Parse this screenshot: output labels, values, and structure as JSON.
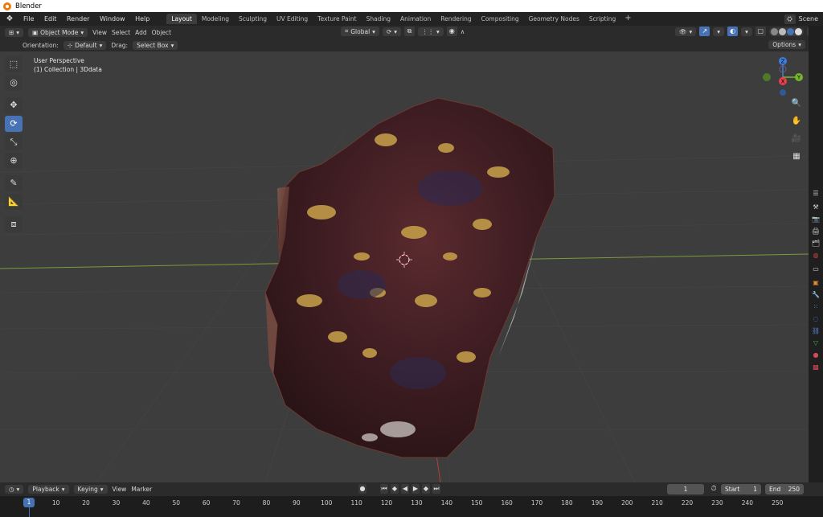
{
  "window": {
    "title": "Blender"
  },
  "menu": {
    "items": [
      "File",
      "Edit",
      "Render",
      "Window",
      "Help"
    ]
  },
  "workspaces": {
    "active": "Layout",
    "tabs": [
      "Layout",
      "Modeling",
      "Sculpting",
      "UV Editing",
      "Texture Paint",
      "Shading",
      "Animation",
      "Rendering",
      "Compositing",
      "Geometry Nodes",
      "Scripting"
    ]
  },
  "scene": {
    "name": "Scene"
  },
  "header": {
    "mode": "Object Mode",
    "menus": [
      "View",
      "Select",
      "Add",
      "Object"
    ],
    "transform_orientation": "Global"
  },
  "tool_settings": {
    "orientation_label": "Orientation:",
    "orientation_value": "Default",
    "drag_label": "Drag:",
    "drag_value": "Select Box",
    "options_label": "Options"
  },
  "viewport": {
    "perspective": "User Perspective",
    "collection": "(1) Collection | 3Ddata"
  },
  "gizmo": {
    "x": "X",
    "y": "Y",
    "z": "Z"
  },
  "timeline": {
    "menus": [
      "Playback",
      "Keying",
      "View",
      "Marker"
    ],
    "current_frame": 1,
    "start_label": "Start",
    "start": 1,
    "end_label": "End",
    "end": 250,
    "ruler_ticks": [
      10,
      20,
      30,
      40,
      50,
      60,
      70,
      80,
      90,
      100,
      110,
      120,
      130,
      140,
      150,
      160,
      170,
      180,
      190,
      200,
      210,
      220,
      230,
      240,
      250
    ]
  },
  "colors": {
    "accent": "#4772b3",
    "x_axis": "#e8424f",
    "y_axis": "#76b82a",
    "z_axis": "#3f7fdb"
  }
}
